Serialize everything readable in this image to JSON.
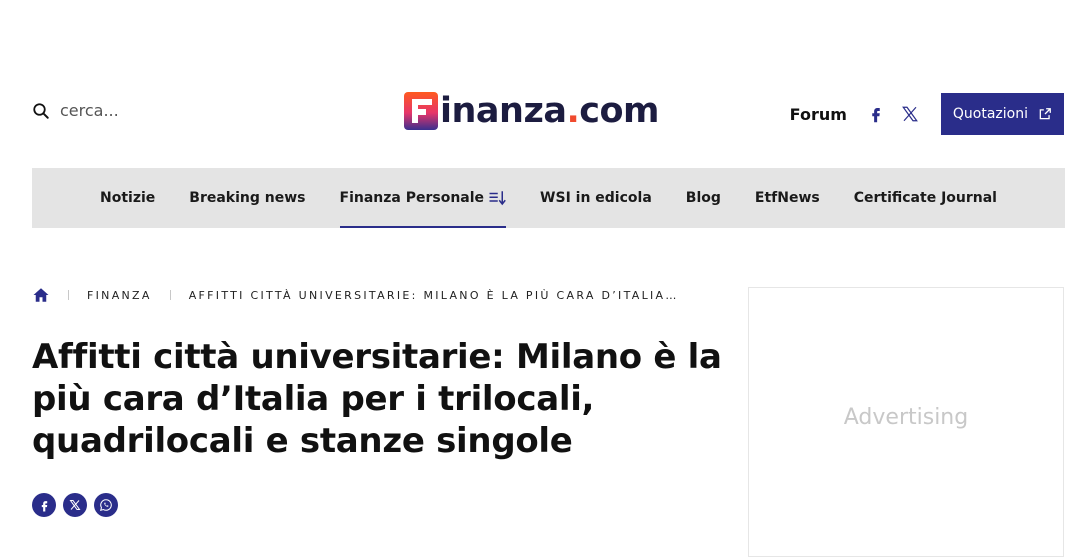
{
  "header": {
    "search_placeholder": "cerca...",
    "logo_text": "inanza",
    "logo_dot": ".",
    "logo_suffix": "com",
    "forum_label": "Forum",
    "quote_label": "Quotazioni"
  },
  "nav": {
    "items": [
      {
        "label": "Notizie"
      },
      {
        "label": "Breaking news"
      },
      {
        "label": "Finanza Personale",
        "active": true
      },
      {
        "label": "WSI in edicola"
      },
      {
        "label": "Blog"
      },
      {
        "label": "EtfNews"
      },
      {
        "label": "Certificate Journal"
      }
    ]
  },
  "breadcrumb": {
    "section": "FINANZA",
    "current": "AFFITTI CITTÀ UNIVERSITARIE: MILANO È LA PIÙ CARA D’ITALIA…"
  },
  "article": {
    "title": "Affitti città universitarie: Milano è la più cara d’Italia per i trilocali, quadrilocali e stanze singole"
  },
  "ad": {
    "label": "Advertising"
  },
  "colors": {
    "brand_navy": "#2a2d8a",
    "logo_red": "#f04a2e",
    "nav_bg": "#e4e4e4"
  },
  "icons": [
    "search-icon",
    "finanza-logo-mark",
    "facebook-icon",
    "x-icon",
    "external-link-icon",
    "sort-icon",
    "home-icon",
    "whatsapp-icon"
  ]
}
